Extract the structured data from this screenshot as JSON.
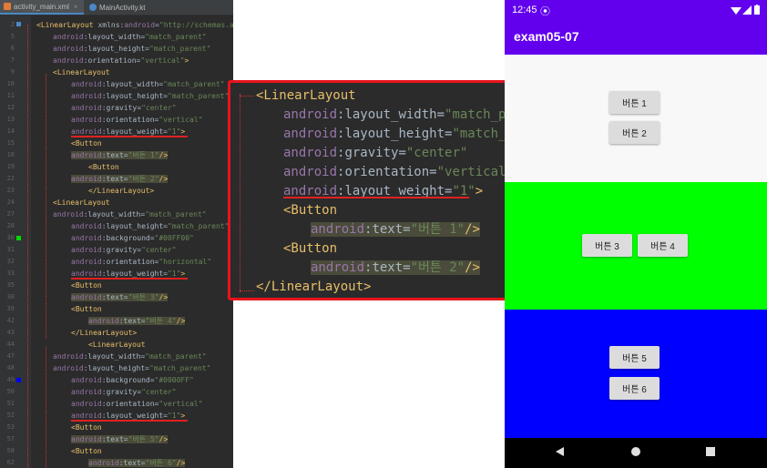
{
  "ide": {
    "tabs": [
      {
        "label": "activity_main.xml",
        "icon": "xml-file-icon",
        "color": "#e07b39"
      },
      {
        "label": "MainActivity.kt",
        "icon": "kotlin-file-icon",
        "color": "#4a88c7"
      }
    ],
    "lines": [
      {
        "n": "2",
        "parts": [
          [
            "tg",
            "<LinearLayout "
          ],
          [
            "pn",
            "xmlns:"
          ],
          [
            "at",
            "android"
          ],
          [
            "pn",
            "="
          ],
          [
            "av",
            "\"http://schemas.a"
          ]
        ]
      },
      {
        "n": "5",
        "parts": [
          [
            "at",
            "android"
          ],
          [
            "pn",
            ":layout_width="
          ],
          [
            "av",
            "\"match_parent\""
          ]
        ]
      },
      {
        "n": "6",
        "parts": [
          [
            "at",
            "android"
          ],
          [
            "pn",
            ":layout_height="
          ],
          [
            "av",
            "\"match_parent\""
          ]
        ]
      },
      {
        "n": "7",
        "parts": [
          [
            "at",
            "android"
          ],
          [
            "pn",
            ":orientation="
          ],
          [
            "av",
            "\"vertical\""
          ],
          [
            "tg",
            ">"
          ]
        ]
      },
      {
        "n": "9",
        "parts": [
          [
            "tg",
            "<LinearLayout"
          ]
        ]
      },
      {
        "n": "10",
        "parts": [
          [
            "at",
            "android"
          ],
          [
            "pn",
            ":layout_width="
          ],
          [
            "av",
            "\"match_parent\""
          ]
        ]
      },
      {
        "n": "11",
        "parts": [
          [
            "at",
            "android"
          ],
          [
            "pn",
            ":layout_height="
          ],
          [
            "av",
            "\"match_parent\""
          ]
        ]
      },
      {
        "n": "12",
        "parts": [
          [
            "at",
            "android"
          ],
          [
            "pn",
            ":gravity="
          ],
          [
            "av",
            "\"center\""
          ]
        ]
      },
      {
        "n": "13",
        "parts": [
          [
            "at",
            "android"
          ],
          [
            "pn",
            ":orientation="
          ],
          [
            "av",
            "\"vertical\""
          ]
        ]
      },
      {
        "n": "14",
        "parts": [
          [
            "at",
            "android"
          ],
          [
            "pn",
            ":layout_weight="
          ],
          [
            "av",
            "\"1\""
          ],
          [
            "tg",
            ">"
          ]
        ]
      },
      {
        "n": "15",
        "parts": [
          [
            "tg",
            "<Button"
          ]
        ]
      },
      {
        "n": "18",
        "parts": [
          [
            "at",
            "android"
          ],
          [
            "pn",
            ":text="
          ],
          [
            "av",
            "\"버튼 1\""
          ],
          [
            "tg",
            "/>"
          ]
        ]
      },
      {
        "n": "19",
        "parts": [
          [
            "tg",
            "<Button"
          ]
        ]
      },
      {
        "n": "22",
        "parts": [
          [
            "at",
            "android"
          ],
          [
            "pn",
            ":text="
          ],
          [
            "av",
            "\"버튼 2\""
          ],
          [
            "tg",
            "/>"
          ]
        ]
      },
      {
        "n": "23",
        "parts": [
          [
            "tg",
            "</LinearLayout>"
          ]
        ]
      },
      {
        "n": "24",
        "parts": [
          [
            "tg",
            "<LinearLayout"
          ]
        ]
      },
      {
        "n": "27",
        "parts": [
          [
            "at",
            "android"
          ],
          [
            "pn",
            ":layout_width="
          ],
          [
            "av",
            "\"match_parent\""
          ]
        ]
      },
      {
        "n": "28",
        "parts": [
          [
            "at",
            "android"
          ],
          [
            "pn",
            ":layout_height="
          ],
          [
            "av",
            "\"match_parent\""
          ]
        ]
      },
      {
        "n": "30",
        "parts": [
          [
            "at",
            "android"
          ],
          [
            "pn",
            ":background="
          ],
          [
            "av",
            "\"#00FF00\""
          ]
        ]
      },
      {
        "n": "31",
        "parts": [
          [
            "at",
            "android"
          ],
          [
            "pn",
            ":gravity="
          ],
          [
            "av",
            "\"center\""
          ]
        ]
      },
      {
        "n": "32",
        "parts": [
          [
            "at",
            "android"
          ],
          [
            "pn",
            ":orientation="
          ],
          [
            "av",
            "\"horizontal\""
          ]
        ]
      },
      {
        "n": "33",
        "parts": [
          [
            "at",
            "android"
          ],
          [
            "pn",
            ":layout_weight="
          ],
          [
            "av",
            "\"1\""
          ],
          [
            "tg",
            ">"
          ]
        ]
      },
      {
        "n": "35",
        "parts": [
          [
            "tg",
            "<Button"
          ]
        ]
      },
      {
        "n": "38",
        "parts": [
          [
            "at",
            "android"
          ],
          [
            "pn",
            ":text="
          ],
          [
            "av",
            "\"버튼 3\""
          ],
          [
            "tg",
            "/>"
          ]
        ]
      },
      {
        "n": "39",
        "parts": [
          [
            "tg",
            "<Button"
          ]
        ]
      },
      {
        "n": "42",
        "parts": [
          [
            "at",
            "android"
          ],
          [
            "pn",
            ":text="
          ],
          [
            "av",
            "\"버튼 4\""
          ],
          [
            "tg",
            "/>"
          ]
        ]
      },
      {
        "n": "43",
        "parts": [
          [
            "tg",
            "</LinearLayout>"
          ]
        ]
      },
      {
        "n": "44",
        "parts": [
          [
            "tg",
            "<LinearLayout"
          ]
        ]
      },
      {
        "n": "47",
        "parts": [
          [
            "at",
            "android"
          ],
          [
            "pn",
            ":layout_width="
          ],
          [
            "av",
            "\"match_parent\""
          ]
        ]
      },
      {
        "n": "48",
        "parts": [
          [
            "at",
            "android"
          ],
          [
            "pn",
            ":layout_height="
          ],
          [
            "av",
            "\"match_parent\""
          ]
        ]
      },
      {
        "n": "49",
        "parts": [
          [
            "at",
            "android"
          ],
          [
            "pn",
            ":background="
          ],
          [
            "av",
            "\"#0000FF\""
          ]
        ]
      },
      {
        "n": "50",
        "parts": [
          [
            "at",
            "android"
          ],
          [
            "pn",
            ":gravity="
          ],
          [
            "av",
            "\"center\""
          ]
        ]
      },
      {
        "n": "51",
        "parts": [
          [
            "at",
            "android"
          ],
          [
            "pn",
            ":orientation="
          ],
          [
            "av",
            "\"vertical\""
          ]
        ]
      },
      {
        "n": "52",
        "parts": [
          [
            "at",
            "android"
          ],
          [
            "pn",
            ":layout_weight="
          ],
          [
            "av",
            "\"1\""
          ],
          [
            "tg",
            ">"
          ]
        ]
      },
      {
        "n": "53",
        "parts": [
          [
            "tg",
            "<Button"
          ]
        ]
      },
      {
        "n": "57",
        "parts": [
          [
            "at",
            "android"
          ],
          [
            "pn",
            ":text="
          ],
          [
            "av",
            "\"버튼 5\""
          ],
          [
            "tg",
            "/>"
          ]
        ]
      },
      {
        "n": "58",
        "parts": [
          [
            "tg",
            "<Button"
          ]
        ]
      },
      {
        "n": "62",
        "parts": [
          [
            "at",
            "android"
          ],
          [
            "pn",
            ":text="
          ],
          [
            "av",
            "\"버튼 6\""
          ],
          [
            "tg",
            "/>"
          ]
        ]
      }
    ]
  },
  "zoom": {
    "lines": [
      [
        [
          "tg",
          "<LinearLayout"
        ]
      ],
      [
        [
          "at",
          "android"
        ],
        [
          "pn",
          ":layout_width="
        ],
        [
          "av",
          "\"match_parent\""
        ]
      ],
      [
        [
          "at",
          "android"
        ],
        [
          "pn",
          ":layout_height="
        ],
        [
          "av",
          "\"match_parent\""
        ]
      ],
      [
        [
          "at",
          "android"
        ],
        [
          "pn",
          ":gravity="
        ],
        [
          "av",
          "\"center\""
        ]
      ],
      [
        [
          "at",
          "android"
        ],
        [
          "pn",
          ":orientation="
        ],
        [
          "av",
          "\"vertical\""
        ]
      ],
      [
        [
          "at",
          "android"
        ],
        [
          "pn",
          ":layout_weight="
        ],
        [
          "av",
          "\"1\""
        ],
        [
          "tg",
          ">"
        ]
      ],
      [
        [
          "tg",
          "<Button"
        ]
      ],
      [
        [
          "at",
          "android"
        ],
        [
          "pn",
          ":text="
        ],
        [
          "av",
          "\"버튼 1\""
        ],
        [
          "tg",
          "/>"
        ]
      ],
      [
        [
          "tg",
          "<Button"
        ]
      ],
      [
        [
          "at",
          "android"
        ],
        [
          "pn",
          ":text="
        ],
        [
          "av",
          "\"버튼 2\""
        ],
        [
          "tg",
          "/>"
        ]
      ],
      [
        [
          "tg",
          "</LinearLayout>"
        ]
      ]
    ]
  },
  "phone": {
    "status_time": "12:45",
    "app_title": "exam05-07",
    "section_colors": [
      "#f8f8f8",
      "#00ff00",
      "#0000ff"
    ],
    "accent": "#6200ee",
    "buttons": [
      "버튼 1",
      "버튼 2",
      "버튼 3",
      "버튼 4",
      "버튼 5",
      "버튼 6"
    ],
    "nav_icons": [
      "back-icon",
      "home-icon",
      "recents-icon"
    ]
  }
}
